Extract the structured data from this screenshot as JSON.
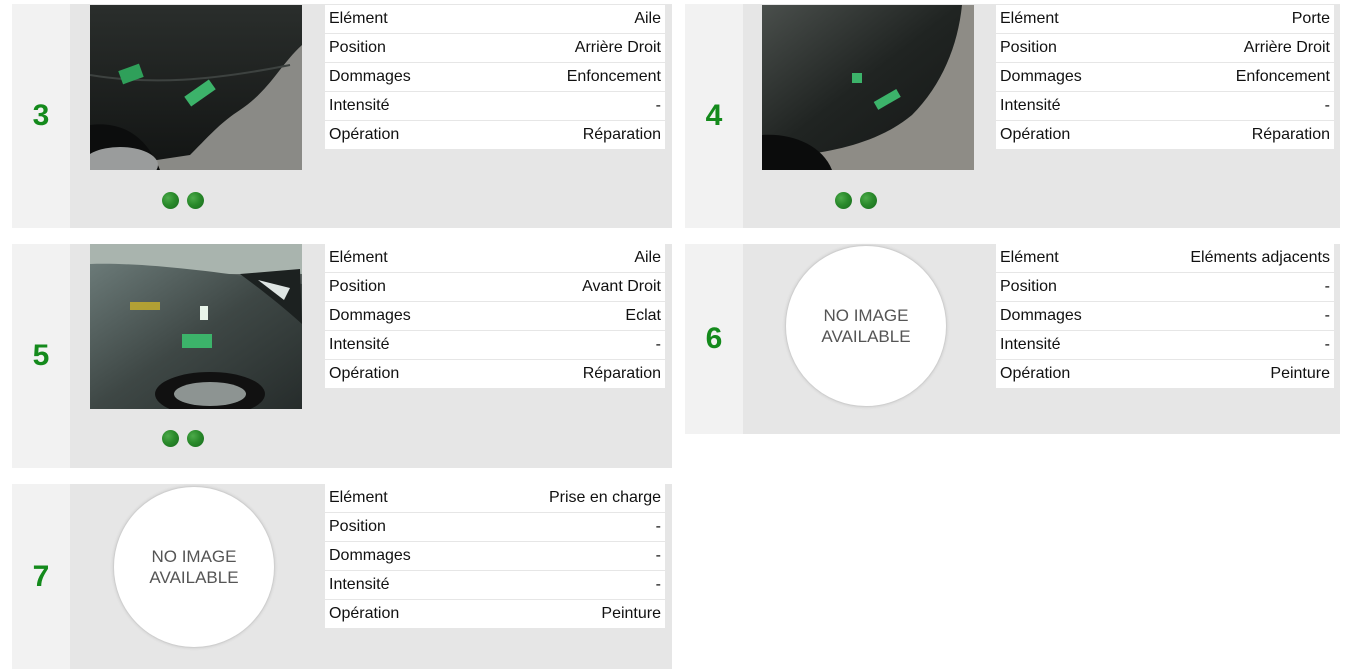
{
  "cards": [
    {
      "number": "3",
      "rows": [
        {
          "label": "Elément",
          "value": "Aile"
        },
        {
          "label": "Position",
          "value": "Arrière Droit"
        },
        {
          "label": "Dommages",
          "value": "Enfoncement"
        },
        {
          "label": "Intensité",
          "value": "-"
        },
        {
          "label": "Opération",
          "value": "Réparation"
        }
      ]
    },
    {
      "number": "4",
      "rows": [
        {
          "label": "Elément",
          "value": "Porte"
        },
        {
          "label": "Position",
          "value": "Arrière Droit"
        },
        {
          "label": "Dommages",
          "value": "Enfoncement"
        },
        {
          "label": "Intensité",
          "value": "-"
        },
        {
          "label": "Opération",
          "value": "Réparation"
        }
      ]
    },
    {
      "number": "5",
      "rows": [
        {
          "label": "Elément",
          "value": "Aile"
        },
        {
          "label": "Position",
          "value": "Avant Droit"
        },
        {
          "label": "Dommages",
          "value": "Eclat"
        },
        {
          "label": "Intensité",
          "value": "-"
        },
        {
          "label": "Opération",
          "value": "Réparation"
        }
      ]
    },
    {
      "number": "6",
      "no_image_text": "NO IMAGE AVAILABLE",
      "rows": [
        {
          "label": "Elément",
          "value": "Eléments adjacents"
        },
        {
          "label": "Position",
          "value": "-"
        },
        {
          "label": "Dommages",
          "value": "-"
        },
        {
          "label": "Intensité",
          "value": "-"
        },
        {
          "label": "Opération",
          "value": "Peinture"
        }
      ]
    },
    {
      "number": "7",
      "no_image_text": "NO IMAGE AVAILABLE",
      "rows": [
        {
          "label": "Elément",
          "value": "Prise en charge"
        },
        {
          "label": "Position",
          "value": "-"
        },
        {
          "label": "Dommages",
          "value": "-"
        },
        {
          "label": "Intensité",
          "value": "-"
        },
        {
          "label": "Opération",
          "value": "Peinture"
        }
      ]
    }
  ],
  "colors": {
    "number": "#148a1c",
    "dot": "#2a8a2b",
    "card_bg": "#e6e6e6",
    "number_col_bg": "#f2f2f2"
  }
}
